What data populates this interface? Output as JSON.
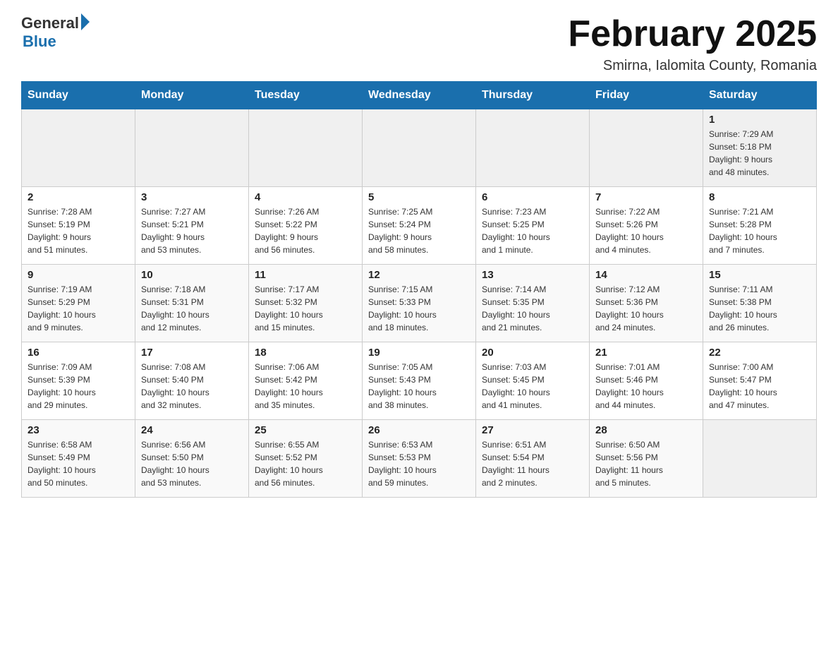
{
  "header": {
    "logo_general": "General",
    "logo_blue": "Blue",
    "month_title": "February 2025",
    "location": "Smirna, Ialomita County, Romania"
  },
  "weekdays": [
    "Sunday",
    "Monday",
    "Tuesday",
    "Wednesday",
    "Thursday",
    "Friday",
    "Saturday"
  ],
  "weeks": [
    [
      {
        "day": "",
        "info": ""
      },
      {
        "day": "",
        "info": ""
      },
      {
        "day": "",
        "info": ""
      },
      {
        "day": "",
        "info": ""
      },
      {
        "day": "",
        "info": ""
      },
      {
        "day": "",
        "info": ""
      },
      {
        "day": "1",
        "info": "Sunrise: 7:29 AM\nSunset: 5:18 PM\nDaylight: 9 hours\nand 48 minutes."
      }
    ],
    [
      {
        "day": "2",
        "info": "Sunrise: 7:28 AM\nSunset: 5:19 PM\nDaylight: 9 hours\nand 51 minutes."
      },
      {
        "day": "3",
        "info": "Sunrise: 7:27 AM\nSunset: 5:21 PM\nDaylight: 9 hours\nand 53 minutes."
      },
      {
        "day": "4",
        "info": "Sunrise: 7:26 AM\nSunset: 5:22 PM\nDaylight: 9 hours\nand 56 minutes."
      },
      {
        "day": "5",
        "info": "Sunrise: 7:25 AM\nSunset: 5:24 PM\nDaylight: 9 hours\nand 58 minutes."
      },
      {
        "day": "6",
        "info": "Sunrise: 7:23 AM\nSunset: 5:25 PM\nDaylight: 10 hours\nand 1 minute."
      },
      {
        "day": "7",
        "info": "Sunrise: 7:22 AM\nSunset: 5:26 PM\nDaylight: 10 hours\nand 4 minutes."
      },
      {
        "day": "8",
        "info": "Sunrise: 7:21 AM\nSunset: 5:28 PM\nDaylight: 10 hours\nand 7 minutes."
      }
    ],
    [
      {
        "day": "9",
        "info": "Sunrise: 7:19 AM\nSunset: 5:29 PM\nDaylight: 10 hours\nand 9 minutes."
      },
      {
        "day": "10",
        "info": "Sunrise: 7:18 AM\nSunset: 5:31 PM\nDaylight: 10 hours\nand 12 minutes."
      },
      {
        "day": "11",
        "info": "Sunrise: 7:17 AM\nSunset: 5:32 PM\nDaylight: 10 hours\nand 15 minutes."
      },
      {
        "day": "12",
        "info": "Sunrise: 7:15 AM\nSunset: 5:33 PM\nDaylight: 10 hours\nand 18 minutes."
      },
      {
        "day": "13",
        "info": "Sunrise: 7:14 AM\nSunset: 5:35 PM\nDaylight: 10 hours\nand 21 minutes."
      },
      {
        "day": "14",
        "info": "Sunrise: 7:12 AM\nSunset: 5:36 PM\nDaylight: 10 hours\nand 24 minutes."
      },
      {
        "day": "15",
        "info": "Sunrise: 7:11 AM\nSunset: 5:38 PM\nDaylight: 10 hours\nand 26 minutes."
      }
    ],
    [
      {
        "day": "16",
        "info": "Sunrise: 7:09 AM\nSunset: 5:39 PM\nDaylight: 10 hours\nand 29 minutes."
      },
      {
        "day": "17",
        "info": "Sunrise: 7:08 AM\nSunset: 5:40 PM\nDaylight: 10 hours\nand 32 minutes."
      },
      {
        "day": "18",
        "info": "Sunrise: 7:06 AM\nSunset: 5:42 PM\nDaylight: 10 hours\nand 35 minutes."
      },
      {
        "day": "19",
        "info": "Sunrise: 7:05 AM\nSunset: 5:43 PM\nDaylight: 10 hours\nand 38 minutes."
      },
      {
        "day": "20",
        "info": "Sunrise: 7:03 AM\nSunset: 5:45 PM\nDaylight: 10 hours\nand 41 minutes."
      },
      {
        "day": "21",
        "info": "Sunrise: 7:01 AM\nSunset: 5:46 PM\nDaylight: 10 hours\nand 44 minutes."
      },
      {
        "day": "22",
        "info": "Sunrise: 7:00 AM\nSunset: 5:47 PM\nDaylight: 10 hours\nand 47 minutes."
      }
    ],
    [
      {
        "day": "23",
        "info": "Sunrise: 6:58 AM\nSunset: 5:49 PM\nDaylight: 10 hours\nand 50 minutes."
      },
      {
        "day": "24",
        "info": "Sunrise: 6:56 AM\nSunset: 5:50 PM\nDaylight: 10 hours\nand 53 minutes."
      },
      {
        "day": "25",
        "info": "Sunrise: 6:55 AM\nSunset: 5:52 PM\nDaylight: 10 hours\nand 56 minutes."
      },
      {
        "day": "26",
        "info": "Sunrise: 6:53 AM\nSunset: 5:53 PM\nDaylight: 10 hours\nand 59 minutes."
      },
      {
        "day": "27",
        "info": "Sunrise: 6:51 AM\nSunset: 5:54 PM\nDaylight: 11 hours\nand 2 minutes."
      },
      {
        "day": "28",
        "info": "Sunrise: 6:50 AM\nSunset: 5:56 PM\nDaylight: 11 hours\nand 5 minutes."
      },
      {
        "day": "",
        "info": ""
      }
    ]
  ]
}
